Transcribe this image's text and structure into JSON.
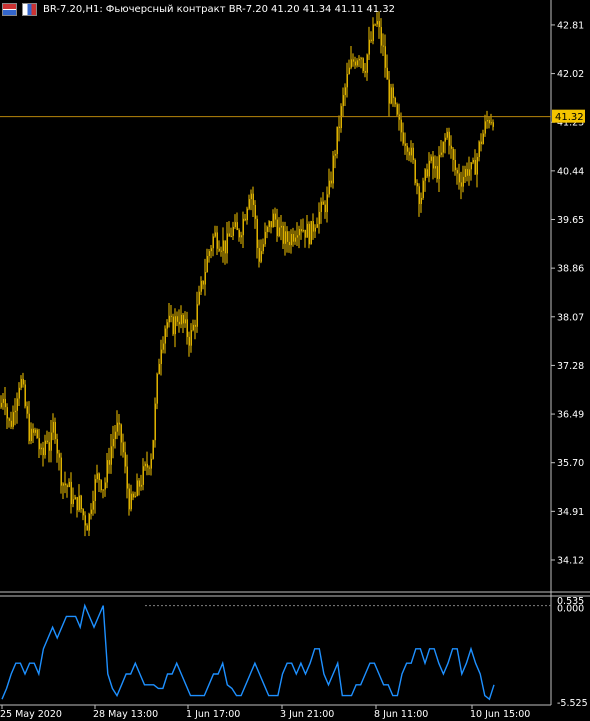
{
  "header": {
    "symbol_period": "BR-7.20,H1:",
    "description": "Фьючерсный контракт BR-7.20",
    "ohlc": "41.20 41.34 41.11 41.32"
  },
  "colors": {
    "background": "#000000",
    "candle": "#f5c400",
    "price_line": "#b8860b",
    "badge": "#f5c400",
    "indicator": "#1e90ff",
    "axis": "#c0c0c0",
    "dotted": "#808080"
  },
  "chart_data": [
    {
      "type": "candlestick",
      "title": "BR-7.20,H1: Фьючерсный контракт BR-7.20",
      "ylim": [
        33.6,
        43.15
      ],
      "yticks": [
        42.81,
        42.02,
        41.23,
        40.44,
        39.65,
        38.86,
        38.07,
        37.28,
        36.49,
        35.7,
        34.91,
        34.12
      ],
      "current_price": 41.32,
      "close_path": [
        [
          0,
          36.6
        ],
        [
          4,
          36.9
        ],
        [
          8,
          36.3
        ],
        [
          12,
          36.4
        ],
        [
          16,
          36.8
        ],
        [
          20,
          37.1
        ],
        [
          24,
          36.7
        ],
        [
          30,
          36.1
        ],
        [
          36,
          36.2
        ],
        [
          42,
          35.7
        ],
        [
          46,
          36.2
        ],
        [
          50,
          35.9
        ],
        [
          54,
          36.4
        ],
        [
          58,
          35.8
        ],
        [
          62,
          35.4
        ],
        [
          68,
          35.3
        ],
        [
          74,
          35.0
        ],
        [
          78,
          35.1
        ],
        [
          84,
          34.8
        ],
        [
          88,
          34.7
        ],
        [
          92,
          35.2
        ],
        [
          98,
          35.5
        ],
        [
          104,
          35.3
        ],
        [
          110,
          35.9
        ],
        [
          116,
          36.3
        ],
        [
          122,
          36.0
        ],
        [
          126,
          35.4
        ],
        [
          130,
          35.0
        ],
        [
          134,
          35.1
        ],
        [
          140,
          35.4
        ],
        [
          146,
          35.6
        ],
        [
          152,
          35.9
        ],
        [
          156,
          36.8
        ],
        [
          160,
          37.6
        ],
        [
          166,
          38.0
        ],
        [
          172,
          37.9
        ],
        [
          178,
          38.1
        ],
        [
          184,
          37.9
        ],
        [
          190,
          37.7
        ],
        [
          196,
          38.1
        ],
        [
          202,
          38.6
        ],
        [
          208,
          39.1
        ],
        [
          214,
          39.4
        ],
        [
          220,
          39.3
        ],
        [
          226,
          39.2
        ],
        [
          232,
          39.5
        ],
        [
          238,
          39.4
        ],
        [
          244,
          39.7
        ],
        [
          250,
          40.2
        ],
        [
          254,
          39.8
        ],
        [
          258,
          39.0
        ],
        [
          262,
          39.2
        ],
        [
          268,
          39.5
        ],
        [
          274,
          39.7
        ],
        [
          280,
          39.4
        ],
        [
          286,
          39.3
        ],
        [
          292,
          39.4
        ],
        [
          298,
          39.6
        ],
        [
          304,
          39.5
        ],
        [
          310,
          39.4
        ],
        [
          316,
          39.7
        ],
        [
          322,
          39.8
        ],
        [
          328,
          40.0
        ],
        [
          334,
          40.7
        ],
        [
          340,
          41.3
        ],
        [
          344,
          41.7
        ],
        [
          348,
          42.0
        ],
        [
          352,
          42.2
        ],
        [
          356,
          42.3
        ],
        [
          360,
          42.4
        ],
        [
          364,
          42.1
        ],
        [
          368,
          42.4
        ],
        [
          372,
          42.6
        ],
        [
          376,
          42.9
        ],
        [
          380,
          42.6
        ],
        [
          384,
          42.3
        ],
        [
          388,
          41.7
        ],
        [
          392,
          41.6
        ],
        [
          396,
          41.3
        ],
        [
          400,
          41.1
        ],
        [
          404,
          41.0
        ],
        [
          408,
          40.9
        ],
        [
          412,
          40.6
        ],
        [
          416,
          40.3
        ],
        [
          420,
          40.0
        ],
        [
          424,
          40.2
        ],
        [
          428,
          40.6
        ],
        [
          432,
          40.5
        ],
        [
          436,
          40.4
        ],
        [
          440,
          40.6
        ],
        [
          444,
          40.9
        ],
        [
          448,
          41.1
        ],
        [
          452,
          40.6
        ],
        [
          456,
          40.4
        ],
        [
          460,
          40.3
        ],
        [
          464,
          40.4
        ],
        [
          468,
          40.5
        ],
        [
          472,
          40.4
        ],
        [
          476,
          40.6
        ],
        [
          480,
          40.9
        ],
        [
          484,
          41.1
        ],
        [
          488,
          41.3
        ],
        [
          492,
          41.32
        ]
      ]
    },
    {
      "type": "line",
      "ylim": [
        -5.525,
        0.535
      ],
      "yticks": [
        0.535,
        0.0,
        -5.525
      ],
      "xticks": [
        "25 May 2020",
        "28 May 13:00",
        "1 Jun 17:00",
        "3 Jun 21:00",
        "8 Jun 11:00",
        "10 Jun 15:00"
      ],
      "level": 0.0,
      "values": [
        -5.2,
        -4.6,
        -3.8,
        -3.2,
        -3.2,
        -3.8,
        -3.2,
        -3.2,
        -3.8,
        -2.4,
        -1.8,
        -1.2,
        -1.8,
        -1.2,
        -0.6,
        -0.6,
        -0.6,
        -1.2,
        -0.0,
        -0.6,
        -1.2,
        -0.6,
        -0.0,
        -3.8,
        -4.6,
        -5.0,
        -4.4,
        -3.8,
        -3.8,
        -3.2,
        -3.8,
        -4.4,
        -4.4,
        -4.4,
        -4.6,
        -4.6,
        -3.8,
        -3.8,
        -3.2,
        -3.8,
        -4.4,
        -5.0,
        -5.0,
        -5.0,
        -5.0,
        -4.4,
        -3.8,
        -3.8,
        -3.2,
        -4.4,
        -4.6,
        -5.0,
        -5.0,
        -4.4,
        -3.8,
        -3.2,
        -3.8,
        -4.4,
        -5.0,
        -5.0,
        -5.0,
        -3.8,
        -3.2,
        -3.2,
        -3.8,
        -3.2,
        -3.8,
        -3.2,
        -2.4,
        -2.4,
        -3.8,
        -4.4,
        -3.8,
        -3.2,
        -5.0,
        -5.0,
        -5.0,
        -4.4,
        -4.4,
        -3.8,
        -3.2,
        -3.2,
        -3.8,
        -4.4,
        -4.4,
        -5.0,
        -5.0,
        -3.8,
        -3.2,
        -3.2,
        -2.4,
        -2.4,
        -3.2,
        -2.4,
        -2.4,
        -3.2,
        -3.8,
        -3.2,
        -2.4,
        -2.4,
        -3.8,
        -3.2,
        -2.4,
        -3.2,
        -3.8,
        -5.0,
        -5.2,
        -4.4
      ]
    }
  ]
}
